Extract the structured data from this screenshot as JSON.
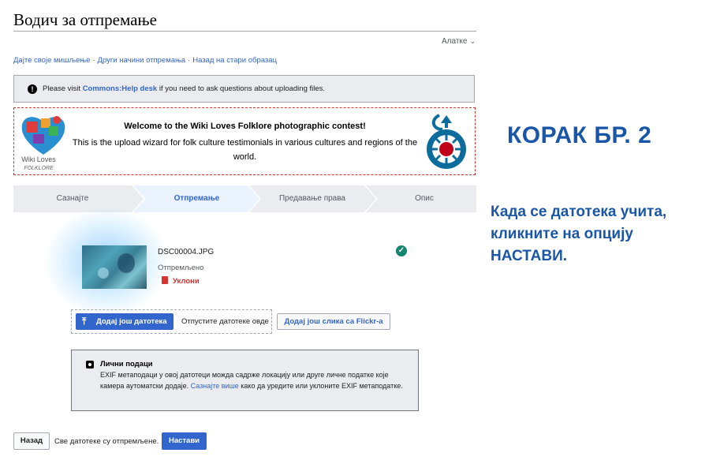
{
  "page": {
    "title": "Водич за отпремање",
    "tools_label": "Алатке",
    "links": [
      "Дајте своје мишљење",
      "Други начини отпремања",
      "Назад на стари образац"
    ]
  },
  "notice": {
    "prefix": "Please visit ",
    "link": "Commons:Help desk",
    "suffix": " if you need to ask questions about uploading files."
  },
  "banner": {
    "logo_line1": "Wiki Loves",
    "logo_line2": "FOLKLORE",
    "heading": "Welcome to the Wiki Loves Folklore photographic contest!",
    "text": "This is the upload wizard for folk culture testimonials in various cultures and regions of the world."
  },
  "steps": [
    {
      "label": "Сазнајте",
      "active": false
    },
    {
      "label": "Отпремање",
      "active": true
    },
    {
      "label": "Предавање права",
      "active": false
    },
    {
      "label": "Опис",
      "active": false
    }
  ],
  "file": {
    "name": "DSC00004.JPG",
    "status": "Отпремљено",
    "remove_label": "Уклони"
  },
  "actions": {
    "add_more": "Додај још датотека",
    "drop_here": "Отпустите датотеке овде",
    "flickr": "Додај још слика са Flickr-a"
  },
  "privacy": {
    "heading": "Лични подаци",
    "body_prefix": "EXIF метаподаци у овој датотеци можда садрже локацију или друге личне податке које камера аутоматски додаје. ",
    "link": "Сазнајте више",
    "body_suffix": " како да уредите или уклоните EXIF метаподатке."
  },
  "footer": {
    "back": "Назад",
    "all_uploaded": "Све датотеке су отпремљене.",
    "next": "Настави"
  },
  "annotation": {
    "heading": "КОРАК БР. 2",
    "text": "Када се датотека учита, кликните на опцију НАСТАВИ."
  },
  "colors": {
    "accent": "#3366cc",
    "annotation": "#1a56a8",
    "success": "#14866d",
    "destructive": "#d73333"
  }
}
